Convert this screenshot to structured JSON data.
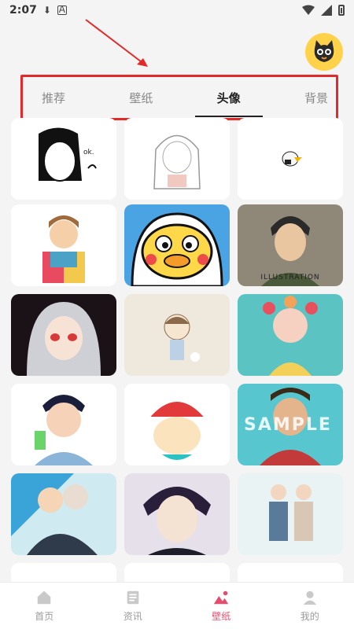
{
  "status": {
    "time": "2:07",
    "a_label": "A"
  },
  "tabs": [
    {
      "label": "推荐",
      "active": false
    },
    {
      "label": "壁纸",
      "active": false
    },
    {
      "label": "头像",
      "active": true
    },
    {
      "label": "背景",
      "active": false
    }
  ],
  "grid_items": [
    {
      "name": "avatar-girl-okay"
    },
    {
      "name": "avatar-sketch-girl"
    },
    {
      "name": "avatar-eagle"
    },
    {
      "name": "avatar-boy-cheek"
    },
    {
      "name": "avatar-duck-hood"
    },
    {
      "name": "avatar-boy-illustration",
      "caption": "ILLUSTRATION"
    },
    {
      "name": "avatar-white-hair-girl"
    },
    {
      "name": "avatar-chibi-girl"
    },
    {
      "name": "avatar-flower-girl"
    },
    {
      "name": "avatar-boy-drink"
    },
    {
      "name": "avatar-santa-boy"
    },
    {
      "name": "avatar-sample-boy",
      "watermark": "SAMPLE"
    },
    {
      "name": "avatar-anime-pair"
    },
    {
      "name": "avatar-anime-boy"
    },
    {
      "name": "avatar-couple"
    }
  ],
  "bottom_nav": [
    {
      "label": "首页",
      "icon": "home-icon",
      "active": false
    },
    {
      "label": "资讯",
      "icon": "news-icon",
      "active": false
    },
    {
      "label": "壁纸",
      "icon": "wallpaper-icon",
      "active": true
    },
    {
      "label": "我的",
      "icon": "profile-icon",
      "active": false
    }
  ],
  "colors": {
    "accent": "#e44d6e",
    "highlight": "#e32a2a",
    "avatar_bg": "#ffd24a"
  }
}
